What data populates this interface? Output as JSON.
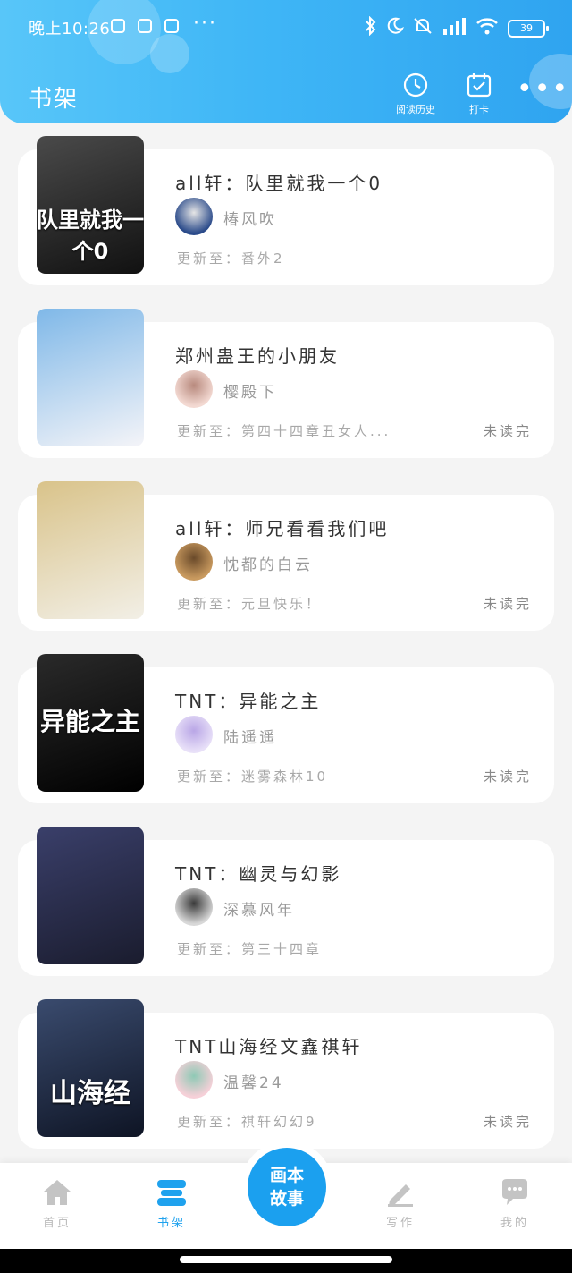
{
  "status_bar": {
    "time": "晚上10:26",
    "dots": "···",
    "battery": "39"
  },
  "header": {
    "title": "书架",
    "history_label": "阅读历史",
    "checkin_label": "打卡",
    "more": "•••"
  },
  "books": [
    {
      "title": "all轩：队里就我一个0",
      "author": "椿风吹",
      "update": "更新至：番外2",
      "status": "",
      "cover_text": "队里就我一个0",
      "cover_colors": [
        "#4a4a4a",
        "#111111"
      ],
      "avatar_colors": [
        "#2a4a8a",
        "#e6e6e6"
      ]
    },
    {
      "title": "郑州蛊王的小朋友",
      "author": "樱殿下",
      "update": "更新至：第四十四章丑女人...",
      "status": "未读完",
      "cover_text": "",
      "cover_colors": [
        "#7fb8e8",
        "#f4f4f8"
      ],
      "avatar_colors": [
        "#f3d9d2",
        "#b88a7e"
      ]
    },
    {
      "title": "all轩：师兄看看我们吧",
      "author": "忱都的白云",
      "update": "更新至：元旦快乐！",
      "status": "未读完",
      "cover_text": "",
      "cover_colors": [
        "#d9c38a",
        "#f2efe6"
      ],
      "avatar_colors": [
        "#c99a5f",
        "#6a4a2a"
      ]
    },
    {
      "title": "TNT：异能之主",
      "author": "陆遥遥",
      "update": "更新至：迷雾森林10",
      "status": "未读完",
      "cover_text": "异能之主",
      "cover_colors": [
        "#2a2a2a",
        "#000000"
      ],
      "avatar_colors": [
        "#e8e0f8",
        "#b9a6e6"
      ]
    },
    {
      "title": "TNT：幽灵与幻影",
      "author": "深慕风年",
      "update": "更新至：第三十四章",
      "status": "",
      "cover_text": "",
      "cover_colors": [
        "#3a3f6a",
        "#1a1c2e"
      ],
      "avatar_colors": [
        "#d8d8d8",
        "#3a3a3a"
      ]
    },
    {
      "title": "TNT山海经文鑫祺轩",
      "author": "温馨24",
      "update": "更新至：祺轩幻幻9",
      "status": "未读完",
      "cover_text": "山海经",
      "cover_colors": [
        "#3a4b6e",
        "#0e1424"
      ],
      "avatar_colors": [
        "#f6d0d8",
        "#8ec9b5"
      ]
    }
  ],
  "bottom_nav": {
    "home": "首页",
    "shelf": "书架",
    "center_line1": "画本",
    "center_line2": "故事",
    "write": "写作",
    "mine": "我的"
  },
  "colors": {
    "accent": "#1fa2ee",
    "header_start": "#58c6f9",
    "header_end": "#2fa4f0"
  }
}
